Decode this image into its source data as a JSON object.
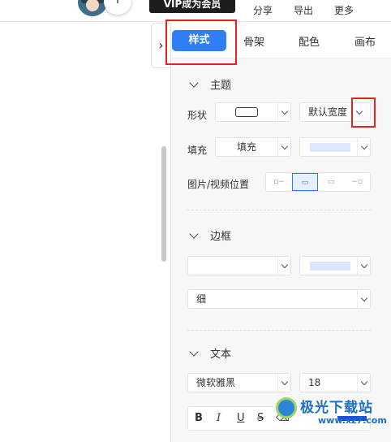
{
  "header": {
    "plus_label": "+",
    "vip_label": "VIP成为会员",
    "actions": [
      "分享",
      "导出",
      "更多"
    ]
  },
  "collapse_glyph": "›",
  "tabs": [
    {
      "label": "样式",
      "active": true
    },
    {
      "label": "骨架",
      "active": false
    },
    {
      "label": "配色",
      "active": false
    },
    {
      "label": "画布",
      "active": false
    }
  ],
  "theme": {
    "title": "主题",
    "shape_label": "形状",
    "width_value": "默认宽度",
    "fill_label": "填充",
    "fill_value": "填充",
    "media_label": "图片/视频位置",
    "fill_swatch": "#dde6fb"
  },
  "border": {
    "title": "边框",
    "weight_value": "细",
    "border_swatch": "#dde6fb"
  },
  "text": {
    "title": "文本",
    "font_value": "微软雅黑",
    "size_value": "18",
    "bold": "B",
    "italic": "I",
    "underline": "U",
    "strike": "S",
    "text_color": "#1c4fd8"
  },
  "accent_color": "#2f7ef8",
  "highlight_color": "#e02424",
  "watermark": {
    "name": "极光下载站",
    "url": "www.xz7.com"
  }
}
